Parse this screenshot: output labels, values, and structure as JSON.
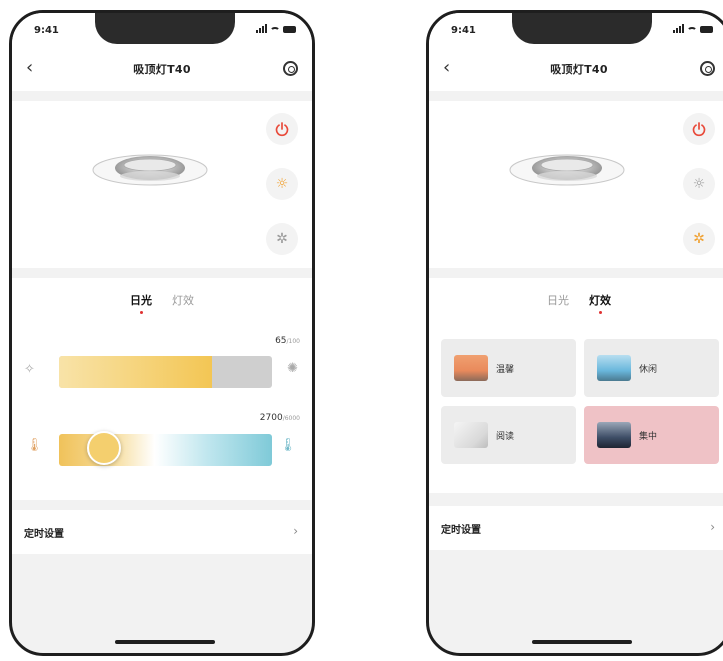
{
  "screens": [
    {
      "status": {
        "time": "9:41"
      },
      "nav": {
        "back": "‹",
        "title": "吸顶灯T40"
      },
      "controls": {
        "power_color": "#e84a3a",
        "daylight_color": "#f0a030",
        "effect_color": "#9a9a9a"
      },
      "tabs": [
        {
          "label": "日光",
          "active": true
        },
        {
          "label": "灯效",
          "active": false
        }
      ],
      "brightness": {
        "value": "65",
        "max": "/100",
        "level": 0.72,
        "fill_color": "#f5cb5a",
        "track_color": "#cfcfcf"
      },
      "color_temp": {
        "value": "2700",
        "max": "/6000",
        "level": 0.21
      },
      "timer": {
        "label": "定时设置",
        "chevron": "›"
      }
    },
    {
      "status": {
        "time": "9:41"
      },
      "nav": {
        "back": "‹",
        "title": "吸顶灯T40"
      },
      "controls": {
        "power_color": "#e84a3a",
        "daylight_color": "#9a9a9a",
        "effect_color": "#f0a030"
      },
      "tabs": [
        {
          "label": "日光",
          "active": false
        },
        {
          "label": "灯效",
          "active": true
        }
      ],
      "effects": [
        {
          "label": "温馨",
          "thumb_color": "#e98a5c",
          "selected": false
        },
        {
          "label": "休闲",
          "thumb_color": "#6ab7dc",
          "selected": false
        },
        {
          "label": "阅读",
          "thumb_color": "#d9d9d9",
          "selected": false
        },
        {
          "label": "集中",
          "thumb_color": "#3d4d66",
          "selected": true
        }
      ],
      "timer": {
        "label": "定时设置",
        "chevron": "›"
      }
    }
  ]
}
